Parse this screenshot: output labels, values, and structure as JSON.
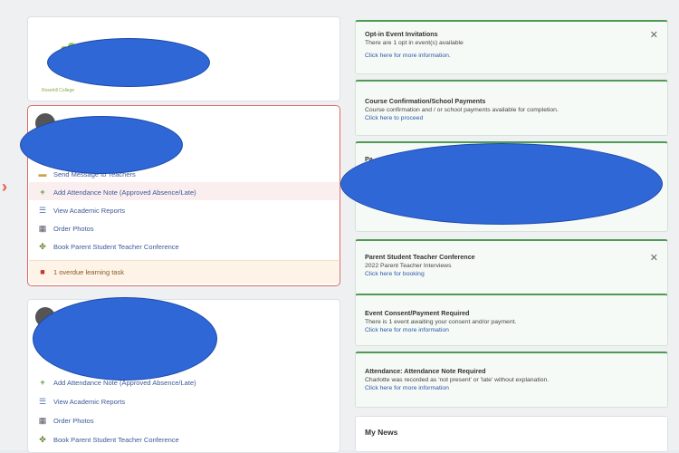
{
  "school": {
    "logo_caption": "Rosehill College"
  },
  "student1": {
    "items": [
      {
        "icon": "folder-icon",
        "label": "Send Message to Teachers"
      },
      {
        "icon": "plus-icon",
        "label": "Add Attendance Note (Approved Absence/Late)"
      },
      {
        "icon": "report-icon",
        "label": "View Academic Reports"
      },
      {
        "icon": "photo-icon",
        "label": "Order Photos"
      },
      {
        "icon": "people-icon",
        "label": "Book Parent Student Teacher Conference"
      }
    ],
    "task": "1 overdue learning task"
  },
  "student2": {
    "items": [
      {
        "icon": "plus-icon",
        "label": "Add Attendance Note (Approved Absence/Late)"
      },
      {
        "icon": "report-icon",
        "label": "View Academic Reports"
      },
      {
        "icon": "photo-icon",
        "label": "Order Photos"
      },
      {
        "icon": "people-icon",
        "label": "Book Parent Student Teacher Conference"
      }
    ]
  },
  "notices": [
    {
      "title": "Opt-in Event Invitations",
      "body": "There are 1 opt in event(s) available",
      "link": "Click here for more information.",
      "closable": true
    },
    {
      "title": "Course Confirmation/School Payments",
      "body": "Course confirmation and / or school payments available for completion.",
      "link": "Click here to proceed",
      "closable": false
    },
    {
      "title": "Pa",
      "body": "",
      "link": "",
      "closable": false
    },
    {
      "title": "Parent Student Teacher Conference",
      "body": "2022 Parent Teacher Interviews",
      "link": "Click here for booking",
      "closable": true
    },
    {
      "title": "Event Consent/Payment Required",
      "body": "There is 1 event awaiting your consent and/or payment.",
      "link": "Click here for more information",
      "closable": false
    },
    {
      "title": "Attendance: Attendance Note Required",
      "body": "Charlotte was recorded as 'not present' or 'late' without explanation.",
      "link": "Click here for more information",
      "closable": false
    }
  ],
  "news": {
    "title": "My News"
  },
  "colors": {
    "accent_green": "#4f9a54",
    "alert_red": "#e06a62",
    "link_blue": "#2a58a8",
    "redaction_blue": "#2f67d6"
  }
}
